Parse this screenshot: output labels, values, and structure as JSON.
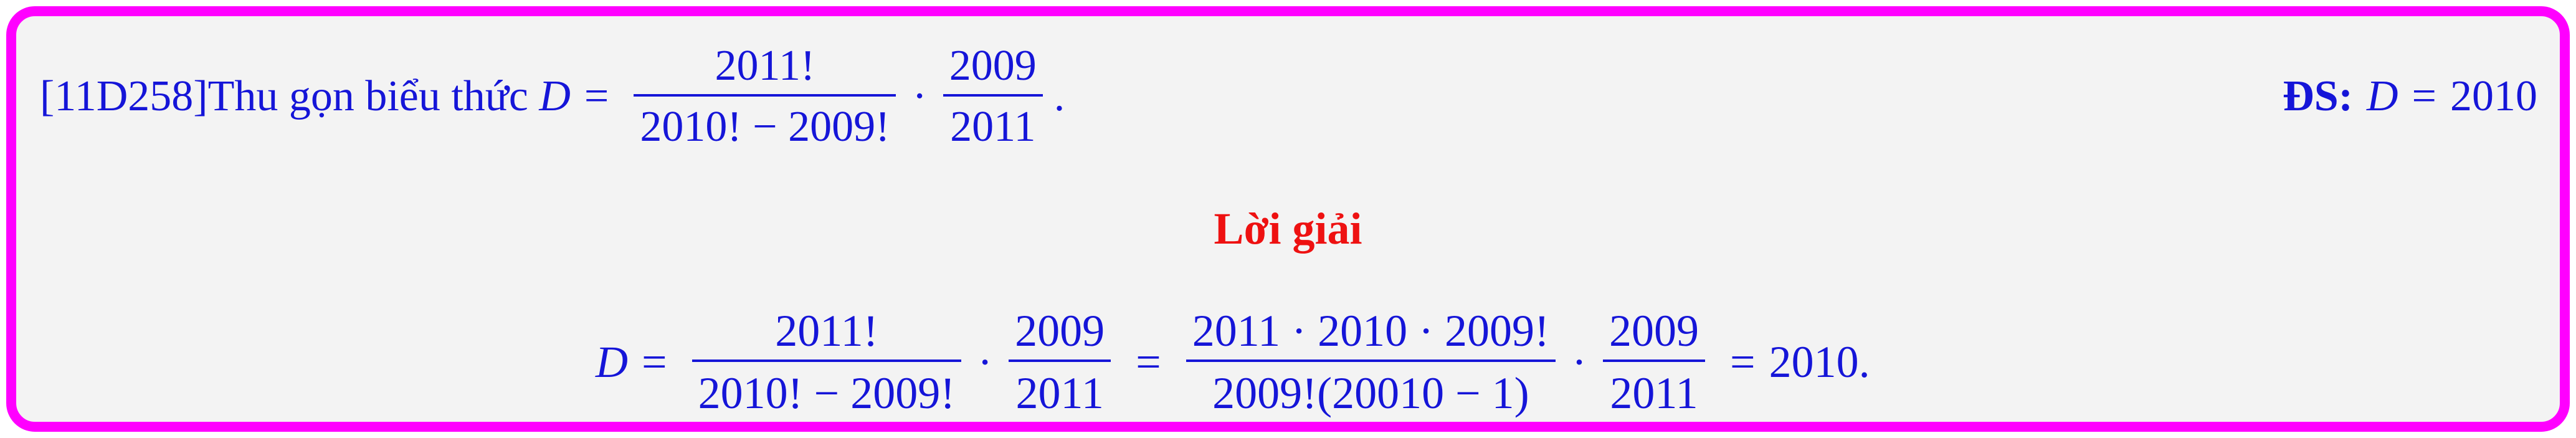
{
  "problem": {
    "code": "[11D258]",
    "text": "Thu gọn biểu thức ",
    "var": "D",
    "eq": "=",
    "frac1": {
      "num": "2011!",
      "den": "2010! − 2009!"
    },
    "dot": "·",
    "frac2": {
      "num": "2009",
      "den": "2011"
    },
    "end": "."
  },
  "answer": {
    "label": "ĐS:",
    "var": "D",
    "eq": "=",
    "value": "2010"
  },
  "solution": {
    "title": "Lời giải",
    "var": "D",
    "eq1": "=",
    "frac1": {
      "num": "2011!",
      "den": "2010! − 2009!"
    },
    "dot1": "·",
    "frac2": {
      "num": "2009",
      "den": "2011"
    },
    "eq2": "=",
    "frac3": {
      "num": "2011 · 2010 · 2009!",
      "den": "2009!(20010 − 1)"
    },
    "dot2": "·",
    "frac4": {
      "num": "2009",
      "den": "2011"
    },
    "eq3": "=",
    "result": "2010."
  },
  "colors": {
    "border": "#ff00ff",
    "background": "#f3f3f3",
    "text": "#1515d8",
    "title": "#ee1111"
  }
}
